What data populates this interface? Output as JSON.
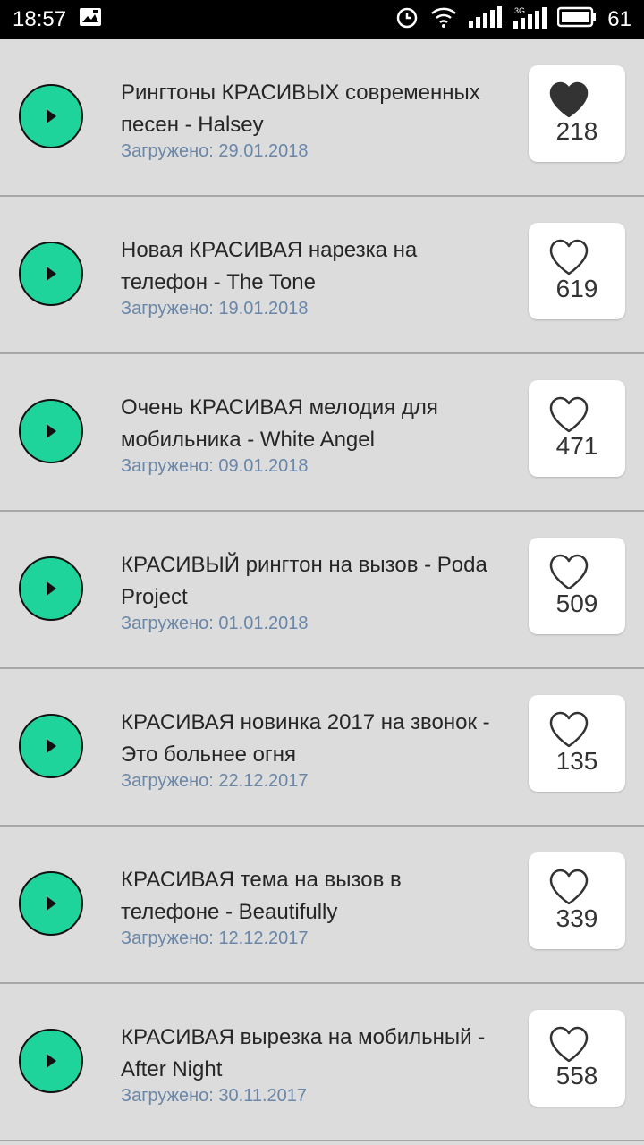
{
  "status_bar": {
    "time": "18:57",
    "battery": "61"
  },
  "items": [
    {
      "title": "Рингтоны КРАСИВЫХ современных песен - Halsey",
      "date": "Загружено: 29.01.2018",
      "likes": "218",
      "liked": true
    },
    {
      "title": "Новая КРАСИВАЯ нарезка на телефон - The Tone",
      "date": "Загружено: 19.01.2018",
      "likes": "619",
      "liked": false
    },
    {
      "title": "Очень КРАСИВАЯ мелодия для мобильника - White Angel",
      "date": "Загружено: 09.01.2018",
      "likes": "471",
      "liked": false
    },
    {
      "title": "КРАСИВЫЙ рингтон на вызов - Poda Project",
      "date": "Загружено: 01.01.2018",
      "likes": "509",
      "liked": false
    },
    {
      "title": "КРАСИВАЯ новинка 2017 на звонок - Это больнее огня",
      "date": "Загружено: 22.12.2017",
      "likes": "135",
      "liked": false
    },
    {
      "title": "КРАСИВАЯ тема на вызов в телефоне - Beautifully",
      "date": "Загружено: 12.12.2017",
      "likes": "339",
      "liked": false
    },
    {
      "title": "КРАСИВАЯ вырезка на мобильный - After Night",
      "date": "Загружено: 30.11.2017",
      "likes": "558",
      "liked": false
    }
  ],
  "colors": {
    "play": "#1ed49a",
    "date": "#6a86a8",
    "background": "#dcdcdc"
  }
}
